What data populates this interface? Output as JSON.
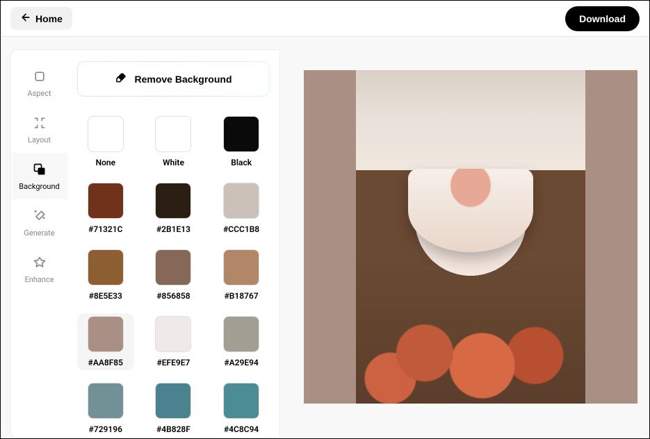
{
  "header": {
    "home_label": "Home",
    "download_label": "Download"
  },
  "sidebar": {
    "tabs": [
      {
        "id": "aspect",
        "label": "Aspect"
      },
      {
        "id": "layout",
        "label": "Layout"
      },
      {
        "id": "background",
        "label": "Background"
      },
      {
        "id": "generate",
        "label": "Generate"
      },
      {
        "id": "enhance",
        "label": "Enhance"
      }
    ],
    "active": "background"
  },
  "panel": {
    "remove_bg_label": "Remove Background",
    "selected_swatch": "#AA8F85",
    "swatches": [
      {
        "label": "None",
        "color": "#FFFFFF",
        "transparent": true
      },
      {
        "label": "White",
        "color": "#FFFFFF"
      },
      {
        "label": "Black",
        "color": "#0A0A0A"
      },
      {
        "label": "#71321C",
        "color": "#71321C"
      },
      {
        "label": "#2B1E13",
        "color": "#2B1E13"
      },
      {
        "label": "#CCC1B8",
        "color": "#CCC1B8"
      },
      {
        "label": "#8E5E33",
        "color": "#8E5E33"
      },
      {
        "label": "#856858",
        "color": "#856858"
      },
      {
        "label": "#B18767",
        "color": "#B18767"
      },
      {
        "label": "#AA8F85",
        "color": "#AA8F85"
      },
      {
        "label": "#EFE9E7",
        "color": "#EFE9E7"
      },
      {
        "label": "#A29E94",
        "color": "#A29E94"
      },
      {
        "label": "#729196",
        "color": "#729196"
      },
      {
        "label": "#4B828F",
        "color": "#4B828F"
      },
      {
        "label": "#4C8C94",
        "color": "#4C8C94"
      }
    ]
  },
  "canvas": {
    "background_color": "#AA8F85",
    "image_description": "cake with macarons on wooden table with fruit"
  }
}
